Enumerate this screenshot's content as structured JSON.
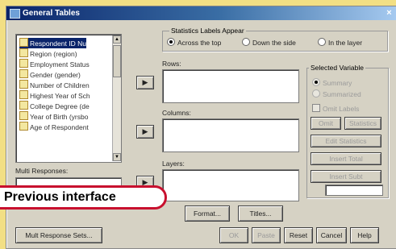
{
  "window": {
    "title": "General Tables",
    "close_glyph": "×"
  },
  "variables": {
    "items": [
      "Respondent ID Nu",
      "Region (region)",
      "Employment Status",
      "Gender (gender)",
      "Number of Children",
      "Highest Year of Sch",
      "College Degree (de",
      "Year of Birth (yrsbo",
      "Age of Respondent"
    ]
  },
  "multi_responses": {
    "label": "Multi Responses:"
  },
  "arrow_glyph": "▶",
  "stat_labels": {
    "title": "Statistics Labels Appear",
    "options": [
      "Across the top",
      "Down the side",
      "In the layer"
    ]
  },
  "rows": {
    "label": "Rows:"
  },
  "columns": {
    "label": "Columns:"
  },
  "layers": {
    "label": "Layers:"
  },
  "selected_variable": {
    "title": "Selected Variable",
    "radios": [
      "Summary",
      "Summarized"
    ],
    "check": "Omit Labels",
    "buttons": [
      "Omit",
      "Statistics",
      "Edit Statistics",
      "Insert Total",
      "Insert Subt"
    ]
  },
  "buttons": {
    "format": "Format...",
    "titles": "Titles...",
    "mult_response_sets": "Mult Response Sets...",
    "ok": "OK",
    "paste": "Paste",
    "reset": "Reset",
    "cancel": "Cancel",
    "help": "Help"
  },
  "callout": {
    "text": "Previous interface"
  },
  "colors": {
    "background": "#f2df84",
    "dialog": "#d6d2c4",
    "titlebar": "#0a246a",
    "callout_border": "#c8102e"
  }
}
